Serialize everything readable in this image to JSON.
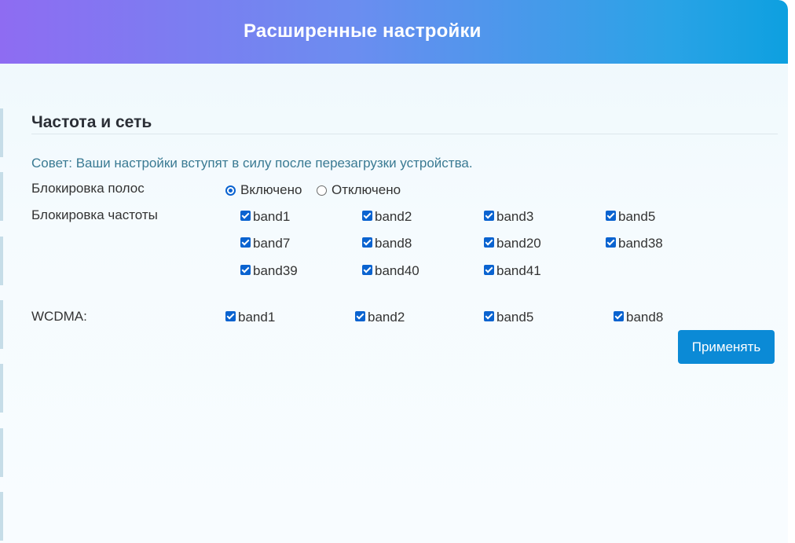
{
  "header": {
    "title": "Расширенные настройки"
  },
  "section": {
    "title": "Частота и сеть",
    "tip": "Совет: Ваши настройки вступят в силу после перезагрузки устройства."
  },
  "band_lock": {
    "label": "Блокировка полос",
    "options": [
      {
        "label": "Включено",
        "selected": true
      },
      {
        "label": "Отключено",
        "selected": false
      }
    ]
  },
  "freq_lock": {
    "label": "Блокировка частоты",
    "bands": [
      {
        "label": "band1",
        "checked": true
      },
      {
        "label": "band2",
        "checked": true
      },
      {
        "label": "band3",
        "checked": true
      },
      {
        "label": "band5",
        "checked": true
      },
      {
        "label": "band7",
        "checked": true
      },
      {
        "label": "band8",
        "checked": true
      },
      {
        "label": "band20",
        "checked": true
      },
      {
        "label": "band38",
        "checked": true
      },
      {
        "label": "band39",
        "checked": true
      },
      {
        "label": "band40",
        "checked": true
      },
      {
        "label": "band41",
        "checked": true
      }
    ]
  },
  "wcdma": {
    "label": "WCDMA:",
    "bands": [
      {
        "label": "band1",
        "checked": true
      },
      {
        "label": "band2",
        "checked": true
      },
      {
        "label": "band5",
        "checked": true
      },
      {
        "label": "band8",
        "checked": true
      }
    ]
  },
  "apply_label": "Применять",
  "colors": {
    "accent": "#0b8ad6",
    "checkbox": "#0a63d0",
    "tip": "#3a7a93"
  }
}
